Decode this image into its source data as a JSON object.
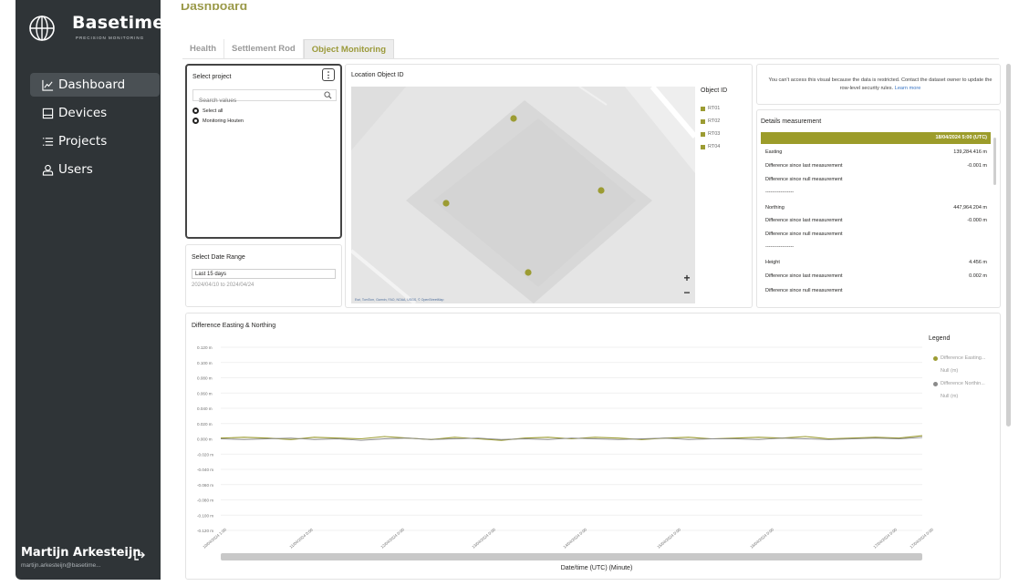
{
  "brand": {
    "name": "Basetime",
    "tagline": "PRECISION MONITORING"
  },
  "sidebar": {
    "items": [
      {
        "label": "Dashboard",
        "icon": "chart-line-icon",
        "active": true
      },
      {
        "label": "Devices",
        "icon": "device-icon",
        "active": false
      },
      {
        "label": "Projects",
        "icon": "list-icon",
        "active": false
      },
      {
        "label": "Users",
        "icon": "user-icon",
        "active": false
      }
    ],
    "user": {
      "name": "Martijn Arkesteijn",
      "email": "martijn.arkesteijn@basetime..."
    }
  },
  "header": {
    "title": "Dashboard"
  },
  "tabs": [
    {
      "label": "Health",
      "active": false
    },
    {
      "label": "Settlement Rod",
      "active": false
    },
    {
      "label": "Object Monitoring",
      "active": true
    }
  ],
  "select_project": {
    "title": "Select project",
    "search_placeholder": "Search values",
    "options": [
      "Select all",
      "Monitoring Houten"
    ]
  },
  "date_range": {
    "title": "Select Date Range",
    "value": "Last 15 days",
    "range_text": "2024/04/10 to 2024/04/24"
  },
  "map": {
    "title": "Location Object ID",
    "legend_title": "Object ID",
    "objects": [
      "RT01",
      "RT02",
      "RT03",
      "RT04"
    ],
    "attribution": "Esri, TomTom, Garmin, FAO, NOAA, USGS, © OpenStreetMap",
    "zoom_in": "+",
    "zoom_out": "−",
    "marker_color": "#9c9c33"
  },
  "restricted": {
    "message": "You can't access this visual because the data is restricted. Contact the dataset owner to update the row-level security rules.",
    "link": "Learn more"
  },
  "details": {
    "title": "Details measurement",
    "header_date": "18/04/2024 5:00 (UTC)",
    "rows": [
      {
        "label": "Easting",
        "value": "139,284.416 m"
      },
      {
        "label": "Difference since last measurement",
        "value": "-0.001 m"
      },
      {
        "label": "Difference since null measurement",
        "value": ""
      },
      {
        "label": "-----------------",
        "value": ""
      },
      {
        "label": "Northing",
        "value": "447,964.204 m"
      },
      {
        "label": "Difference since last measurement",
        "value": "-0.000 m"
      },
      {
        "label": "Difference since null measurement",
        "value": ""
      },
      {
        "label": "-----------------",
        "value": ""
      },
      {
        "label": "Height",
        "value": "4.456 m"
      },
      {
        "label": "Difference since last measurement",
        "value": "0.002 m"
      },
      {
        "label": "Difference since null measurement",
        "value": ""
      }
    ],
    "accent": "#9c9c2a"
  },
  "chart_data": {
    "type": "line",
    "title": "Difference Easting & Northing",
    "xlabel": "Date/time (UTC) (Minute)",
    "ylabel": "",
    "ylim": [
      -0.12,
      0.12
    ],
    "y_ticks": [
      "0.120 m",
      "0.100 m",
      "0.080 m",
      "0.060 m",
      "0.040 m",
      "0.020 m",
      "0.000 m",
      "-0.020 m",
      "-0.040 m",
      "-0.060 m",
      "-0.080 m",
      "-0.100 m",
      "-0.120 m"
    ],
    "x_ticks": [
      "10/04/2024 1:00",
      "11/04/2024 0:00",
      "12/04/2024 0:00",
      "13/04/2024 0:00",
      "14/04/2024 0:00",
      "15/04/2024 0:00",
      "16/04/2024 0:00",
      "17/04/2024 0:00",
      "17/04/2024 0:00"
    ],
    "legend_title": "Legend",
    "series": [
      {
        "name": "Difference Easting...",
        "sub": "Null (m)",
        "color": "#9c9c33",
        "values": [
          0.001,
          0.002,
          0.001,
          -0.001,
          0.002,
          0.001,
          0.0,
          0.003,
          0.001,
          -0.001,
          0.002,
          0.0,
          -0.002,
          0.001,
          0.002,
          0.0,
          0.002,
          0.001,
          -0.001,
          0.001,
          0.002,
          0.0,
          0.001,
          0.002,
          0.001,
          0.003,
          0.0,
          0.001,
          0.002,
          0.001,
          0.004
        ]
      },
      {
        "name": "Difference Northin...",
        "sub": "Null (m)",
        "color": "#8a8a8a",
        "values": [
          0.0,
          -0.001,
          0.0,
          0.001,
          -0.001,
          0.0,
          -0.002,
          0.0,
          0.001,
          -0.001,
          0.0,
          0.001,
          -0.001,
          0.0,
          -0.001,
          0.001,
          0.0,
          -0.001,
          0.0,
          0.001,
          -0.001,
          0.0,
          0.0,
          -0.001,
          0.001,
          0.0,
          -0.001,
          0.0,
          0.001,
          0.0,
          0.002
        ]
      }
    ]
  }
}
